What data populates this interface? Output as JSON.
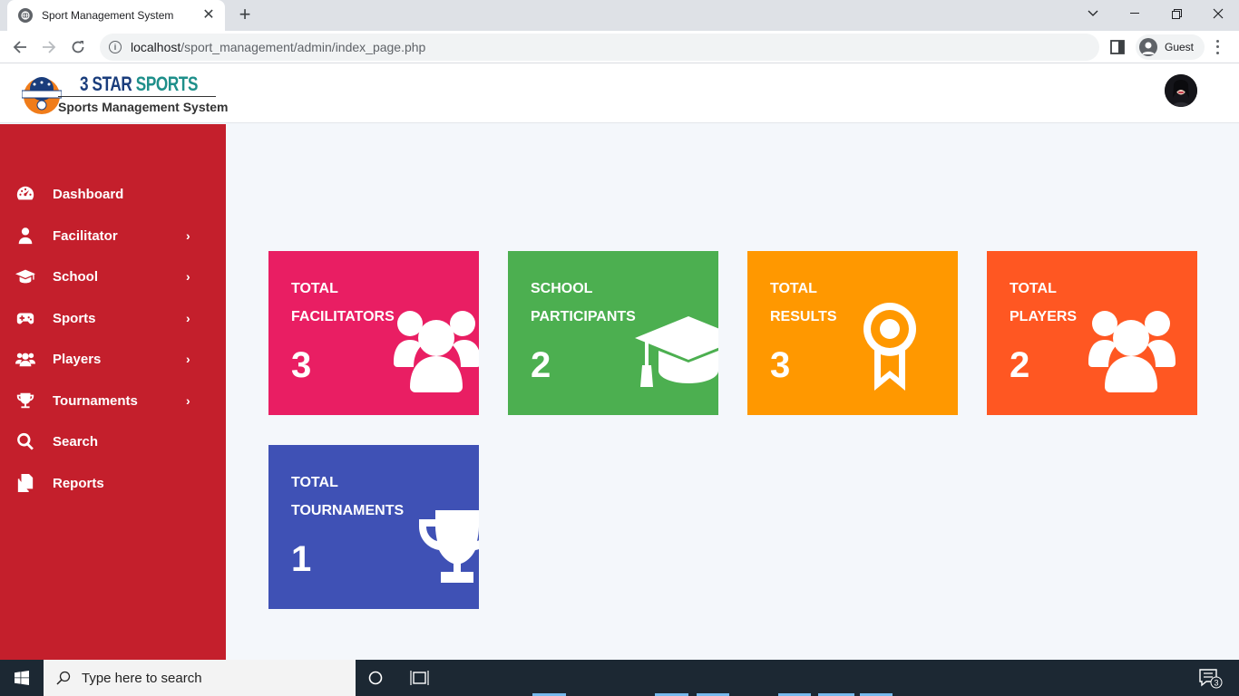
{
  "browser": {
    "tab_title": "Sport Management System",
    "tab_close": "✕",
    "new_tab": "+",
    "url_host": "localhost",
    "url_path": "/sport_management/admin/index_page.php",
    "profile_label": "Guest",
    "window_controls": {
      "dropdown": "⌄",
      "minimize": "—",
      "restore": "❐",
      "close": "✕"
    }
  },
  "header": {
    "logo_title_part1": "3 STAR ",
    "logo_title_part2": "SPORTS",
    "logo_subtitle": "Sports Management System",
    "logo_badge_text": "SPORTS"
  },
  "sidebar": {
    "items": [
      {
        "label": "Dashboard",
        "icon": "dashboard-icon",
        "has_submenu": false
      },
      {
        "label": "Facilitator",
        "icon": "user-icon",
        "has_submenu": true
      },
      {
        "label": "School",
        "icon": "graduation-cap-icon",
        "has_submenu": true
      },
      {
        "label": "Sports",
        "icon": "gamepad-icon",
        "has_submenu": true
      },
      {
        "label": "Players",
        "icon": "users-icon",
        "has_submenu": true
      },
      {
        "label": "Tournaments",
        "icon": "trophy-icon",
        "has_submenu": true
      },
      {
        "label": "Search",
        "icon": "search-icon",
        "has_submenu": false
      },
      {
        "label": "Reports",
        "icon": "reports-icon",
        "has_submenu": false
      }
    ],
    "chevron": "›"
  },
  "cards": [
    {
      "title": "TOTAL\nFACILITATORS",
      "count": "3",
      "color": "#e91e63",
      "icon": "users-icon"
    },
    {
      "title": "SCHOOL\nPARTICIPANTS",
      "count": "2",
      "color": "#4caf50",
      "icon": "graduation-cap-icon"
    },
    {
      "title": "TOTAL\nRESULTS",
      "count": "3",
      "color": "#ff9800",
      "icon": "award-icon"
    },
    {
      "title": "TOTAL\nPLAYERS",
      "count": "2",
      "color": "#ff5722",
      "icon": "users-icon"
    },
    {
      "title": "TOTAL\nTOURNAMENTS",
      "count": "1",
      "color": "#3f51b5",
      "icon": "trophy-icon"
    }
  ],
  "taskbar": {
    "search_placeholder": "Type here to search",
    "notification_count": "3"
  },
  "colors": {
    "sidebar_bg": "#c41f2c",
    "content_bg": "#f4f7fb",
    "taskbar_bg": "#1c2833"
  }
}
